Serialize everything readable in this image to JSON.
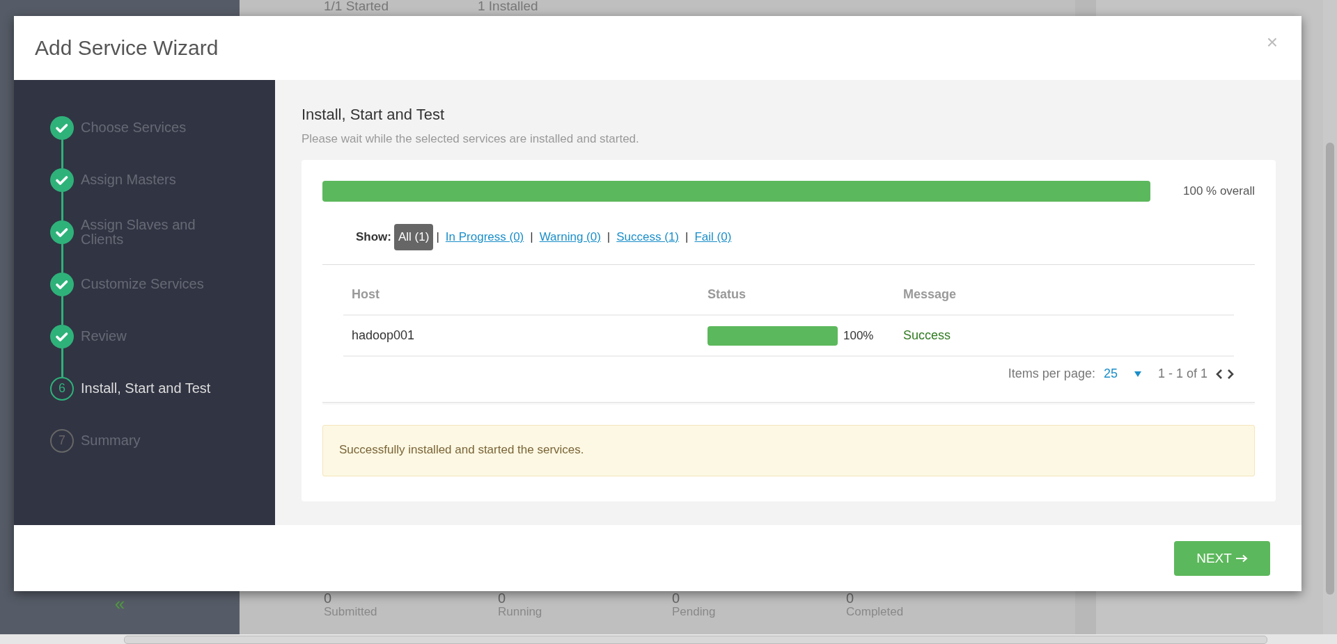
{
  "background": {
    "top_texts": [
      "1/1 Started",
      "1 Installed"
    ],
    "stats": [
      {
        "value": "0",
        "label": "Submitted"
      },
      {
        "value": "0",
        "label": "Running"
      },
      {
        "value": "0",
        "label": "Pending"
      },
      {
        "value": "0",
        "label": "Completed"
      }
    ],
    "collapse": "«"
  },
  "modal": {
    "title": "Add Service Wizard",
    "close": "×"
  },
  "steps": [
    {
      "label": "Choose Services",
      "kind": "done"
    },
    {
      "label": "Assign Masters",
      "kind": "done"
    },
    {
      "label": "Assign Slaves and Clients",
      "kind": "done"
    },
    {
      "label": "Customize Services",
      "kind": "done"
    },
    {
      "label": "Review",
      "kind": "done"
    },
    {
      "label": "Install, Start and Test",
      "kind": "current",
      "number": "6"
    },
    {
      "label": "Summary",
      "kind": "pending",
      "number": "7"
    }
  ],
  "content": {
    "title": "Install, Start and Test",
    "subtitle": "Please wait while the selected services are installed and started.",
    "overall": {
      "level": 1,
      "label": "100 % overall"
    },
    "filters": {
      "label": "Show:",
      "items": [
        {
          "label": "All (1)",
          "selected": true,
          "separator_after": "|"
        },
        {
          "label": "In Progress (0)",
          "selected": false,
          "separator_after": "|"
        },
        {
          "label": "Warning (0)",
          "selected": false,
          "separator_after": "|"
        },
        {
          "label": "Success (1)",
          "selected": false,
          "separator_after": "|"
        },
        {
          "label": "Fail (0)",
          "selected": false
        }
      ]
    },
    "table": {
      "columns": [
        "Host",
        "Status",
        "Message"
      ],
      "rows": [
        {
          "host": "hadoop001",
          "level": 1,
          "percent": "100%",
          "message": "Success",
          "kind": "success"
        }
      ]
    },
    "pagination": {
      "label": "Items per page:",
      "value": "25",
      "range": "1 - 1 of 1"
    },
    "alert": "Successfully installed and started the services."
  },
  "footer": {
    "next": "NEXT"
  }
}
